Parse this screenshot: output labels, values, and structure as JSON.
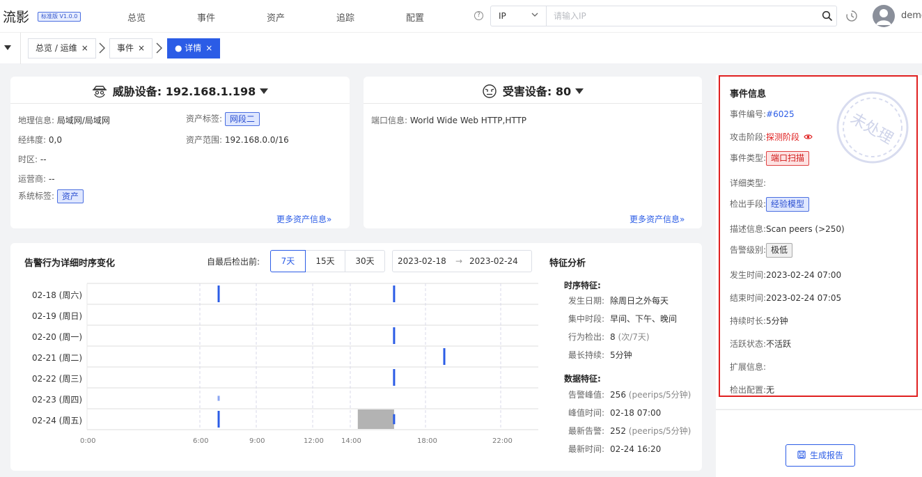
{
  "app": {
    "logo": "流影",
    "version": "标准版 V1.0.0",
    "username": "demo"
  },
  "nav": [
    "总览",
    "事件",
    "资产",
    "追踪",
    "配置"
  ],
  "search": {
    "type": "IP",
    "placeholder": "请输入IP"
  },
  "breadcrumbs": [
    {
      "label": "总览 / 运维",
      "close": "×"
    },
    {
      "label": "事件",
      "close": "×"
    },
    {
      "label": "● 详情",
      "close": "×"
    }
  ],
  "threat_card": {
    "title": "威胁设备: 192.168.1.198",
    "left": [
      {
        "k": "地理信息:",
        "v": "局域网/局域网"
      },
      {
        "k": "经纬度:",
        "v": "0,0"
      },
      {
        "k": "时区:",
        "v": "--"
      },
      {
        "k": "运营商:",
        "v": "--"
      },
      {
        "k": "系统标签:",
        "tag": "资产"
      }
    ],
    "right": [
      {
        "k": "资产标签:",
        "tag": "网段二"
      },
      {
        "k": "资产范围:",
        "v": "192.168.0.0/16"
      }
    ],
    "more": "更多资产信息»"
  },
  "victim_card": {
    "title": "受害设备: 80",
    "port_label": "端口信息:",
    "port_value": "World Wide Web HTTP,HTTP",
    "more": "更多资产信息»"
  },
  "timeline": {
    "title": "告警行为详细时序变化",
    "filter_label": "自最后检出前:",
    "ranges": [
      "7天",
      "15天",
      "30天"
    ],
    "active_range": "7天",
    "date_start": "2023-02-18",
    "date_arrow": "→",
    "date_end": "2023-02-24",
    "rows": [
      "02-18 (周六)",
      "02-19 (周日)",
      "02-20 (周一)",
      "02-21 (周二)",
      "02-22 (周三)",
      "02-23 (周四)",
      "02-24 (周五)"
    ],
    "x_ticks": [
      "0:00",
      "6:00",
      "9:00",
      "12:00",
      "14:00",
      "18:00",
      "22:00"
    ],
    "x_tick_hours": [
      0,
      6,
      9,
      12,
      14,
      18,
      22
    ],
    "events": [
      {
        "row": 0,
        "hour": 7.0,
        "strength": 1
      },
      {
        "row": 0,
        "hour": 16.33,
        "strength": 1
      },
      {
        "row": 2,
        "hour": 16.33,
        "strength": 1
      },
      {
        "row": 3,
        "hour": 19.0,
        "strength": 1
      },
      {
        "row": 4,
        "hour": 16.33,
        "strength": 1
      },
      {
        "row": 5,
        "hour": 7.0,
        "strength": 0.3
      },
      {
        "row": 6,
        "hour": 7.0,
        "strength": 1
      },
      {
        "row": 6,
        "hour": 16.33,
        "strength": 0.6
      }
    ],
    "highlight": {
      "row": 6,
      "start_hour": 14.4,
      "end_hour": 16.33
    },
    "colors": {
      "event": "#2b5ce6",
      "highlight": "#b3b3b3"
    }
  },
  "features": {
    "title": "特征分析",
    "timing_title": "时序特征:",
    "timing": [
      {
        "k": "发生日期:",
        "v": "除周日之外每天"
      },
      {
        "k": "集中时段:",
        "v": "早间、下午、晚间"
      },
      {
        "k": "行为检出:",
        "v": "8",
        "u": "(次/7天)"
      },
      {
        "k": "最长持续:",
        "v": "5分钟"
      }
    ],
    "data_title": "数据特征:",
    "data": [
      {
        "k": "告警峰值:",
        "v": "256",
        "u": "(peerips/5分钟)"
      },
      {
        "k": "峰值时间:",
        "v": "02-18 07:00"
      },
      {
        "k": "最新告警:",
        "v": "252",
        "u": "(peerips/5分钟)"
      },
      {
        "k": "最新时间:",
        "v": "02-24 16:20"
      }
    ]
  },
  "event_info": {
    "title": "事件信息",
    "stamp": "未处理",
    "rows": [
      {
        "k": "事件编号:",
        "v": "#6025",
        "style": "link"
      },
      {
        "k": "攻击阶段:",
        "v": "探测阶段",
        "style": "red"
      },
      {
        "k": "事件类型:",
        "v": "端口扫描",
        "style": "tag-red"
      },
      {
        "k": "详细类型:",
        "v": ""
      },
      {
        "k": "检出手段:",
        "v": "经验模型",
        "style": "tag-blue"
      },
      {
        "k": "描述信息:",
        "v": "Scan peers (>250)"
      },
      {
        "k": "告警级别:",
        "v": "极低",
        "style": "tag-gray"
      },
      {
        "k": "发生时间:",
        "v": "2023-02-24 07:00"
      },
      {
        "k": "结束时间:",
        "v": "2023-02-24 07:05"
      },
      {
        "k": "持续时长:",
        "v": "5分钟"
      },
      {
        "k": "活跃状态:",
        "v": "不活跃"
      },
      {
        "k": "扩展信息:",
        "v": ""
      },
      {
        "k": "检出配置:",
        "v": "无"
      }
    ],
    "report_button": "生成报告"
  }
}
